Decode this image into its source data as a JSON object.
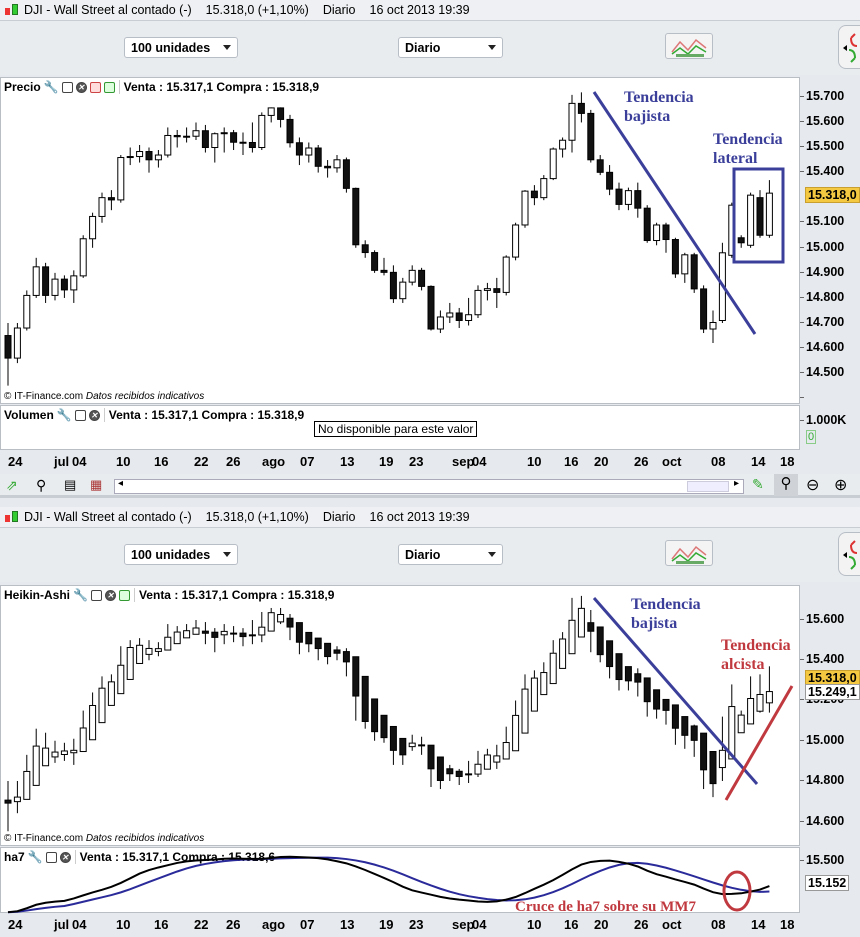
{
  "windows": [
    {
      "title": {
        "symbol": "DJI - Wall Street al contado (-)",
        "price": "15.318,0 (+1,10%)",
        "period": "Diario",
        "datetime": "16 oct 2013 19:39"
      },
      "toolbar": {
        "units": "100 unidades",
        "period": "Diario"
      },
      "main_pane": {
        "name": "Precio",
        "quote": "Venta : 15.317,1 Compra : 15.318,9",
        "chart_type": "candlestick",
        "y_ticks": [
          "15.700",
          "15.600",
          "15.500",
          "15.400",
          "15.200",
          "15.100",
          "15.000",
          "14.900",
          "14.800",
          "14.700",
          "14.600",
          "14.500"
        ],
        "last_price": "15.318,0",
        "annotations": {
          "down": "Tendencia bajista",
          "lateral": "Tendencia lateral"
        }
      },
      "sub_pane": {
        "name": "Volumen",
        "quote": "Venta : 15.317,1 Compra : 15.318,9",
        "message": "No disponible para este valor",
        "y_ticks": [
          "1.000K"
        ],
        "zero": "0"
      },
      "copyright": "© IT-Finance.com",
      "disclaimer": "Datos recibidos indicativos"
    },
    {
      "title": {
        "symbol": "DJI - Wall Street al contado (-)",
        "price": "15.318,0 (+1,10%)",
        "period": "Diario",
        "datetime": "16 oct 2013 19:39"
      },
      "toolbar": {
        "units": "100 unidades",
        "period": "Diario"
      },
      "main_pane": {
        "name": "Heikin-Ashi",
        "quote": "Venta : 15.317,1 Compra : 15.318,9",
        "chart_type": "heikin-ashi",
        "y_ticks": [
          "15.600",
          "15.400",
          "15.200",
          "15.000",
          "14.800",
          "14.600"
        ],
        "last_price": "15.318,0",
        "second_price": "15.249,1",
        "annotations": {
          "down": "Tendencia bajista",
          "up": "Tendencia alcista"
        }
      },
      "sub_pane": {
        "name": "ha7",
        "quote": "Venta : 15.317,1 Compra : 15.318,6",
        "y_ticks": [
          "15.500"
        ],
        "last_value": "15.152",
        "annotation": "Cruce de ha7 sobre su MM7",
        "line_colors": {
          "ha7": "#000000",
          "mm7": "#2a2a9a"
        }
      },
      "copyright": "© IT-Finance.com",
      "disclaimer": "Datos recibidos indicativos"
    }
  ],
  "x_labels": [
    "24",
    "jul",
    "04",
    "10",
    "16",
    "22",
    "26",
    "ago",
    "07",
    "13",
    "19",
    "23",
    "sep",
    "04",
    "10",
    "16",
    "20",
    "26",
    "oct",
    "08",
    "14",
    "18"
  ],
  "colors": {
    "trend_down": "#3b3f9a",
    "trend_up": "#c0393f",
    "last_price_bg": "#f5c842",
    "up_candle": "#ffffff",
    "down_candle": "#111111"
  },
  "chart_data": {
    "type": "candlestick",
    "ylim": [
      14500,
      15750
    ],
    "ohlc": [
      [
        14750,
        14800,
        14550,
        14660
      ],
      [
        14660,
        14800,
        14640,
        14780
      ],
      [
        14780,
        14930,
        14770,
        14910
      ],
      [
        14910,
        15060,
        14900,
        15024
      ],
      [
        15024,
        15040,
        14880,
        14910
      ],
      [
        14910,
        15000,
        14890,
        14975
      ],
      [
        14975,
        14990,
        14900,
        14932
      ],
      [
        14932,
        15010,
        14880,
        14988
      ],
      [
        14988,
        15150,
        14980,
        15136
      ],
      [
        15136,
        15240,
        15100,
        15225
      ],
      [
        15225,
        15320,
        15200,
        15300
      ],
      [
        15300,
        15330,
        15250,
        15291
      ],
      [
        15291,
        15470,
        15280,
        15460
      ],
      [
        15460,
        15500,
        15430,
        15464
      ],
      [
        15464,
        15510,
        15440,
        15484
      ],
      [
        15484,
        15500,
        15400,
        15451
      ],
      [
        15451,
        15490,
        15420,
        15470
      ],
      [
        15470,
        15580,
        15460,
        15548
      ],
      [
        15548,
        15570,
        15500,
        15543
      ],
      [
        15543,
        15580,
        15520,
        15545
      ],
      [
        15545,
        15600,
        15530,
        15567
      ],
      [
        15567,
        15590,
        15480,
        15500
      ],
      [
        15500,
        15560,
        15440,
        15555
      ],
      [
        15555,
        15580,
        15480,
        15559
      ],
      [
        15559,
        15570,
        15490,
        15521
      ],
      [
        15521,
        15560,
        15470,
        15520
      ],
      [
        15520,
        15600,
        15480,
        15500
      ],
      [
        15500,
        15640,
        15490,
        15628
      ],
      [
        15628,
        15660,
        15600,
        15658
      ],
      [
        15658,
        15660,
        15580,
        15612
      ],
      [
        15612,
        15630,
        15500,
        15519
      ],
      [
        15519,
        15540,
        15430,
        15470
      ],
      [
        15470,
        15520,
        15440,
        15498
      ],
      [
        15498,
        15510,
        15400,
        15425
      ],
      [
        15425,
        15450,
        15380,
        15419
      ],
      [
        15419,
        15470,
        15400,
        15451
      ],
      [
        15451,
        15460,
        15320,
        15337
      ],
      [
        15337,
        15340,
        15100,
        15112
      ],
      [
        15112,
        15130,
        15060,
        15081
      ],
      [
        15081,
        15090,
        15000,
        15010
      ],
      [
        15010,
        15060,
        14990,
        15002
      ],
      [
        15002,
        15030,
        14880,
        14897
      ],
      [
        14897,
        14980,
        14880,
        14963
      ],
      [
        14963,
        15030,
        14950,
        15010
      ],
      [
        15010,
        15020,
        14930,
        14946
      ],
      [
        14946,
        14950,
        14770,
        14776
      ],
      [
        14776,
        14850,
        14760,
        14824
      ],
      [
        14824,
        14880,
        14800,
        14840
      ],
      [
        14840,
        14860,
        14780,
        14810
      ],
      [
        14810,
        14900,
        14790,
        14833
      ],
      [
        14833,
        14950,
        14820,
        14930
      ],
      [
        14930,
        14960,
        14890,
        14937
      ],
      [
        14937,
        14980,
        14860,
        14922
      ],
      [
        14922,
        15070,
        14910,
        15063
      ],
      [
        15063,
        15200,
        15050,
        15191
      ],
      [
        15191,
        15330,
        15180,
        15326
      ],
      [
        15326,
        15350,
        15270,
        15300
      ],
      [
        15300,
        15390,
        15290,
        15376
      ],
      [
        15376,
        15500,
        15370,
        15494
      ],
      [
        15494,
        15540,
        15460,
        15529
      ],
      [
        15529,
        15710,
        15480,
        15676
      ],
      [
        15676,
        15720,
        15600,
        15636
      ],
      [
        15636,
        15650,
        15440,
        15451
      ],
      [
        15451,
        15470,
        15390,
        15401
      ],
      [
        15401,
        15430,
        15310,
        15334
      ],
      [
        15334,
        15360,
        15250,
        15273
      ],
      [
        15273,
        15340,
        15250,
        15328
      ],
      [
        15328,
        15360,
        15220,
        15258
      ],
      [
        15258,
        15270,
        15120,
        15129
      ],
      [
        15129,
        15200,
        15110,
        15191
      ],
      [
        15191,
        15200,
        15080,
        15133
      ],
      [
        15133,
        15140,
        14980,
        14996
      ],
      [
        14996,
        15080,
        14960,
        15072
      ],
      [
        15072,
        15080,
        14920,
        14936
      ],
      [
        14936,
        14950,
        14760,
        14776
      ],
      [
        14776,
        14850,
        14720,
        14802
      ],
      [
        14810,
        15120,
        14800,
        15080
      ],
      [
        15070,
        15280,
        15060,
        15270
      ],
      [
        15140,
        15150,
        15100,
        15120
      ],
      [
        15110,
        15320,
        15100,
        15310
      ],
      [
        15300,
        15330,
        15140,
        15150
      ],
      [
        15150,
        15370,
        15140,
        15318
      ]
    ]
  }
}
